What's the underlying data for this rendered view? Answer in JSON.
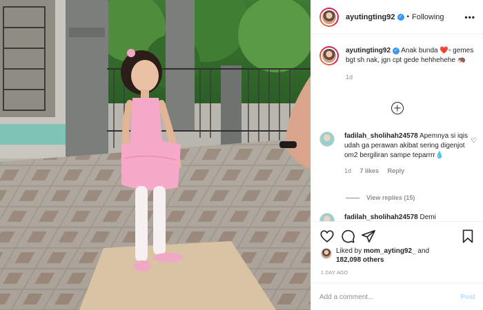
{
  "post": {
    "image_alt": "Girl in pink ballet outfit standing on tiled veranda"
  },
  "header": {
    "username": "ayutingting92",
    "verified_glyph": "✓",
    "separator": "•",
    "follow_state": "Following",
    "more_glyph": "•••"
  },
  "caption": {
    "username": "ayutingting92",
    "text": " Anak bunda ❤️▫ gemes bgt sh nak, jgn cpt gede hehhehehe 🦔",
    "age": "1d"
  },
  "comments": [
    {
      "username": "fadilah_sholihah24578",
      "text": " Apemnya si iqis udah ga perawan akibat sering digenjot om2 bergiliran sampe teparrrr💧",
      "age": "1d",
      "likes": "7 likes",
      "reply": "Reply",
      "view_replies": "View replies (15)"
    },
    {
      "username": "fadilah_sholihah24578",
      "text": " Demi"
    }
  ],
  "actions": {
    "icons": [
      "heart-icon",
      "comment-icon",
      "share-icon",
      "bookmark-icon"
    ],
    "likes_prefix": "Liked by ",
    "likes_user": "mom_ayting92_",
    "likes_mid": " and",
    "likes_count": "182,098 others",
    "time_ago": "1 DAY AGO"
  },
  "add_comment": {
    "placeholder": "Add a comment...",
    "post_label": "Post"
  },
  "colors": {
    "accent": "#3897f0",
    "post_disabled": "#b2dffc",
    "muted": "#8e8e8e"
  }
}
